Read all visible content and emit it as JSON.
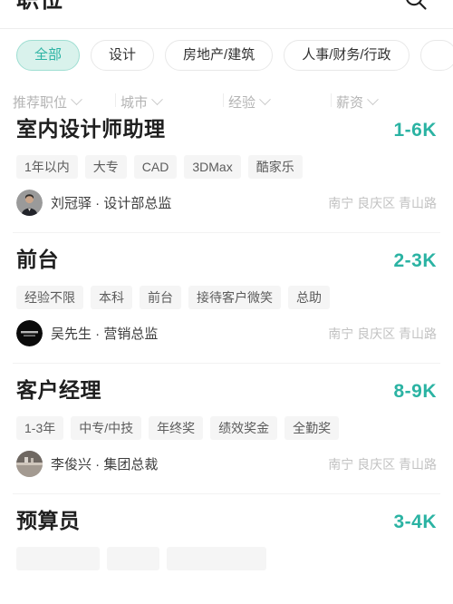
{
  "navbar": {
    "title": "职位",
    "search_icon": "search-icon"
  },
  "categories": {
    "items": [
      {
        "label": "全部",
        "active": true
      },
      {
        "label": "设计",
        "active": false
      },
      {
        "label": "房地产/建筑",
        "active": false
      },
      {
        "label": "人事/财务/行政",
        "active": false
      },
      {
        "label": "",
        "active": false
      }
    ]
  },
  "filters": {
    "items": [
      {
        "label": "推荐职位",
        "icon": "chevron-down-icon"
      },
      {
        "label": "城市",
        "icon": "chevron-down-icon"
      },
      {
        "label": "经验",
        "icon": "chevron-down-icon"
      },
      {
        "label": "薪资",
        "icon": "chevron-down-icon"
      }
    ]
  },
  "colors": {
    "accent": "#2bb3a3",
    "chip_active_bg": "#d9f2ec",
    "chip_active_border": "#9fded2",
    "tag_bg": "#f5f5f5",
    "title": "#1f1f1f",
    "muted": "#c2c2c2"
  },
  "jobs": [
    {
      "title": "室内设计师助理",
      "salary": "1-6K",
      "tags": [
        "1年以内",
        "大专",
        "CAD",
        "3DMax",
        "酷家乐"
      ],
      "recruiter": "刘冠驿 · 设计部总监",
      "location": "南宁 良庆区 青山路",
      "avatar": "person-photo-avatar"
    },
    {
      "title": "前台",
      "salary": "2-3K",
      "tags": [
        "经验不限",
        "本科",
        "前台",
        "接待客户微笑",
        "总助"
      ],
      "recruiter": "吴先生 · 营销总监",
      "location": "南宁 良庆区 青山路",
      "avatar": "logo-dark-avatar"
    },
    {
      "title": "客户经理",
      "salary": "8-9K",
      "tags": [
        "1-3年",
        "中专/中技",
        "年终奖",
        "绩效奖金",
        "全勤奖"
      ],
      "recruiter": "李俊兴 · 集团总裁",
      "location": "南宁 良庆区 青山路",
      "avatar": "interior-photo-avatar"
    },
    {
      "title": "预算员",
      "salary": "3-4K",
      "tags": [
        "",
        "",
        ""
      ],
      "recruiter": "",
      "location": "",
      "avatar": ""
    }
  ]
}
